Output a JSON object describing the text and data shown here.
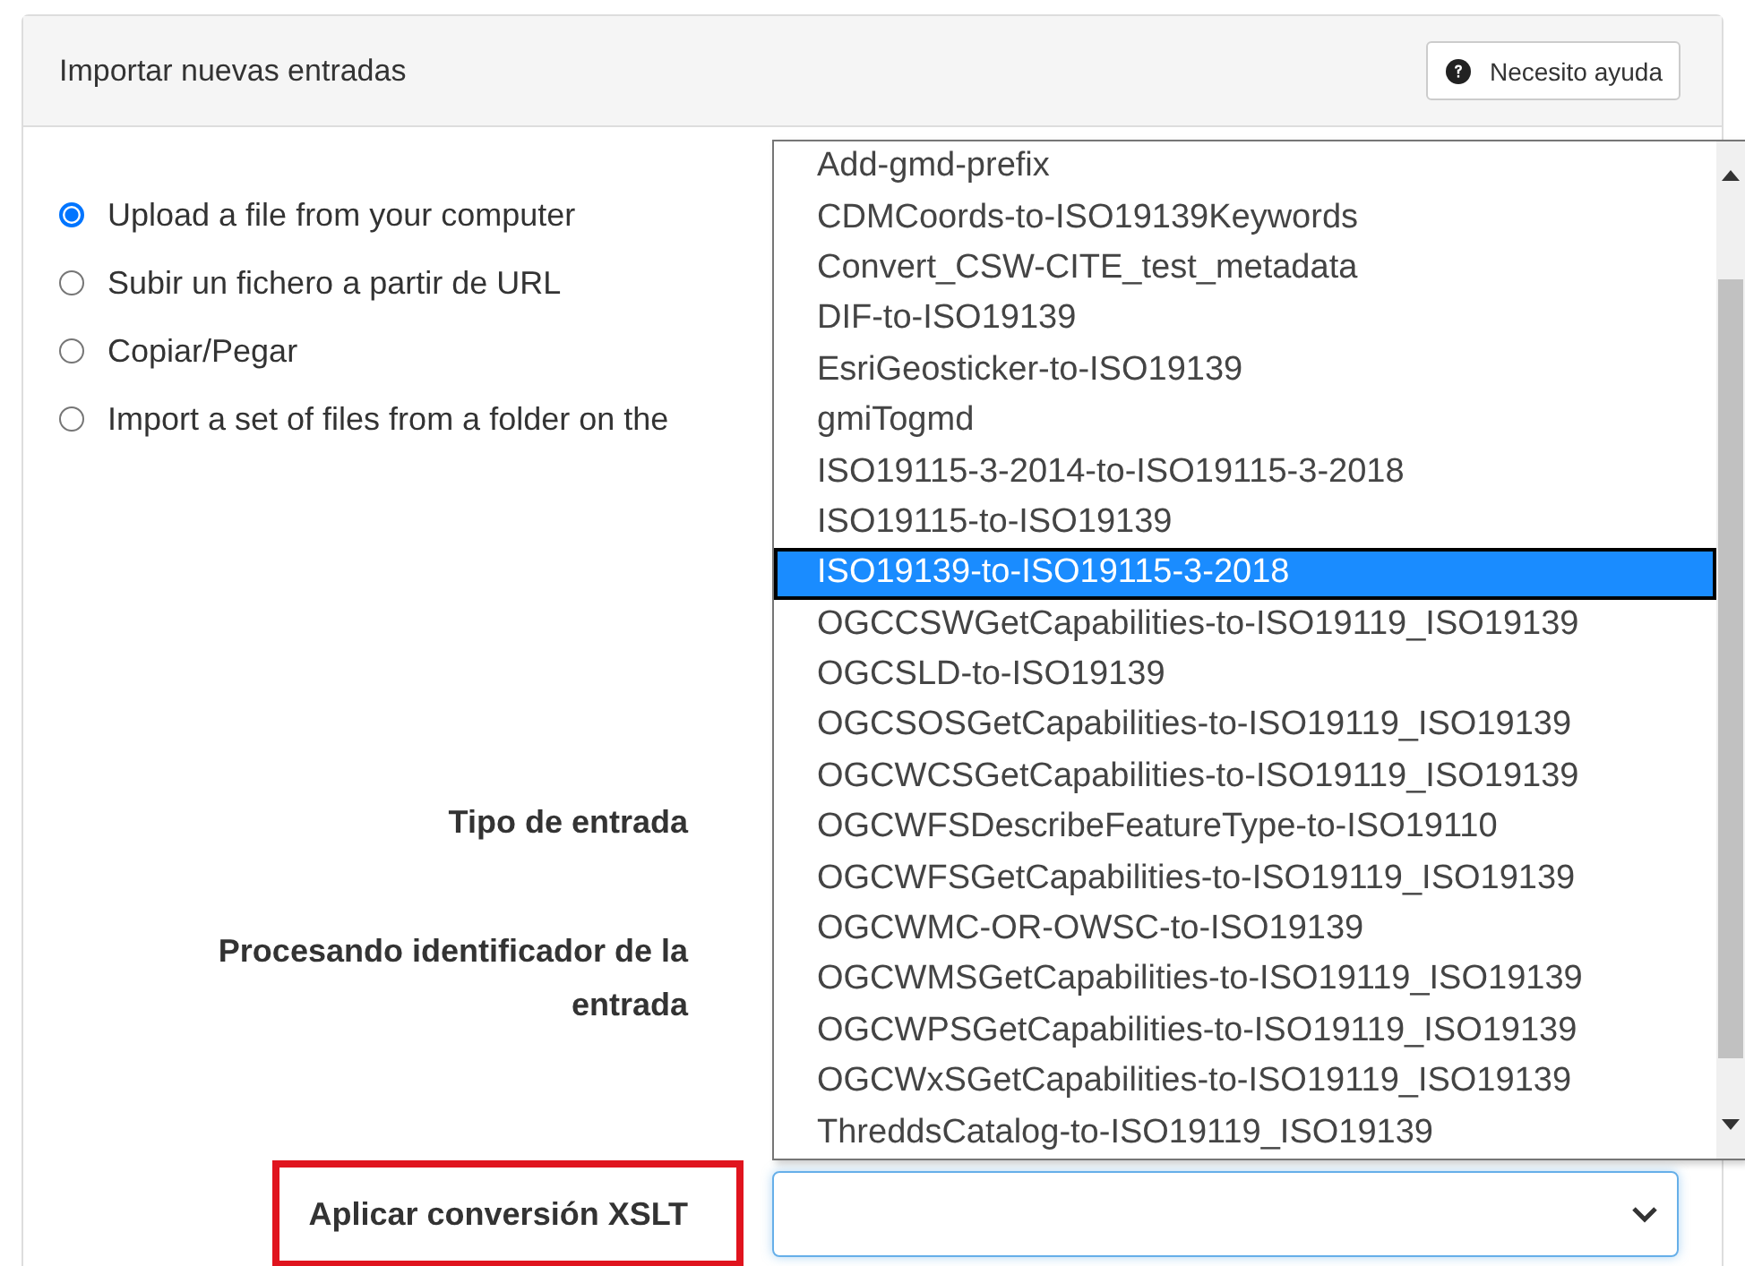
{
  "panel": {
    "title": "Importar nuevas entradas",
    "help_button": {
      "label": "Necesito ayuda"
    }
  },
  "import_options": [
    {
      "label": "Upload a file from your computer",
      "selected": true
    },
    {
      "label": "Subir un fichero a partir de URL",
      "selected": false
    },
    {
      "label": "Copiar/Pegar",
      "selected": false
    },
    {
      "label": "Import a set of files from a folder on the",
      "selected": false
    }
  ],
  "fields": [
    {
      "label": "Tipo de entrada",
      "kind": "label",
      "highlighted": false
    },
    {
      "label": "Procesando identificador de la entrada",
      "kind": "label",
      "highlighted": false
    },
    {
      "label": "Aplicar conversión XSLT",
      "kind": "select",
      "highlighted": true
    }
  ],
  "xslt_dropdown": {
    "options": [
      {
        "label": "Add-gmd-prefix",
        "selected": false
      },
      {
        "label": "CDMCoords-to-ISO19139Keywords",
        "selected": false
      },
      {
        "label": "Convert_CSW-CITE_test_metadata",
        "selected": false
      },
      {
        "label": "DIF-to-ISO19139",
        "selected": false
      },
      {
        "label": "EsriGeosticker-to-ISO19139",
        "selected": false
      },
      {
        "label": "gmiTogmd",
        "selected": false
      },
      {
        "label": "ISO19115-3-2014-to-ISO19115-3-2018",
        "selected": false
      },
      {
        "label": "ISO19115-to-ISO19139",
        "selected": false
      },
      {
        "label": "ISO19139-to-ISO19115-3-2018",
        "selected": true
      },
      {
        "label": "OGCCSWGetCapabilities-to-ISO19119_ISO19139",
        "selected": false
      },
      {
        "label": "OGCSLD-to-ISO19139",
        "selected": false
      },
      {
        "label": "OGCSOSGetCapabilities-to-ISO19119_ISO19139",
        "selected": false
      },
      {
        "label": "OGCWCSGetCapabilities-to-ISO19119_ISO19139",
        "selected": false
      },
      {
        "label": "OGCWFSDescribeFeatureType-to-ISO19110",
        "selected": false
      },
      {
        "label": "OGCWFSGetCapabilities-to-ISO19119_ISO19139",
        "selected": false
      },
      {
        "label": "OGCWMC-OR-OWSC-to-ISO19139",
        "selected": false
      },
      {
        "label": "OGCWMSGetCapabilities-to-ISO19119_ISO19139",
        "selected": false
      },
      {
        "label": "OGCWPSGetCapabilities-to-ISO19119_ISO19139",
        "selected": false
      },
      {
        "label": "OGCWxSGetCapabilities-to-ISO19119_ISO19139",
        "selected": false
      },
      {
        "label": "ThreddsCatalog-to-ISO19119_ISO19139",
        "selected": false
      }
    ]
  }
}
